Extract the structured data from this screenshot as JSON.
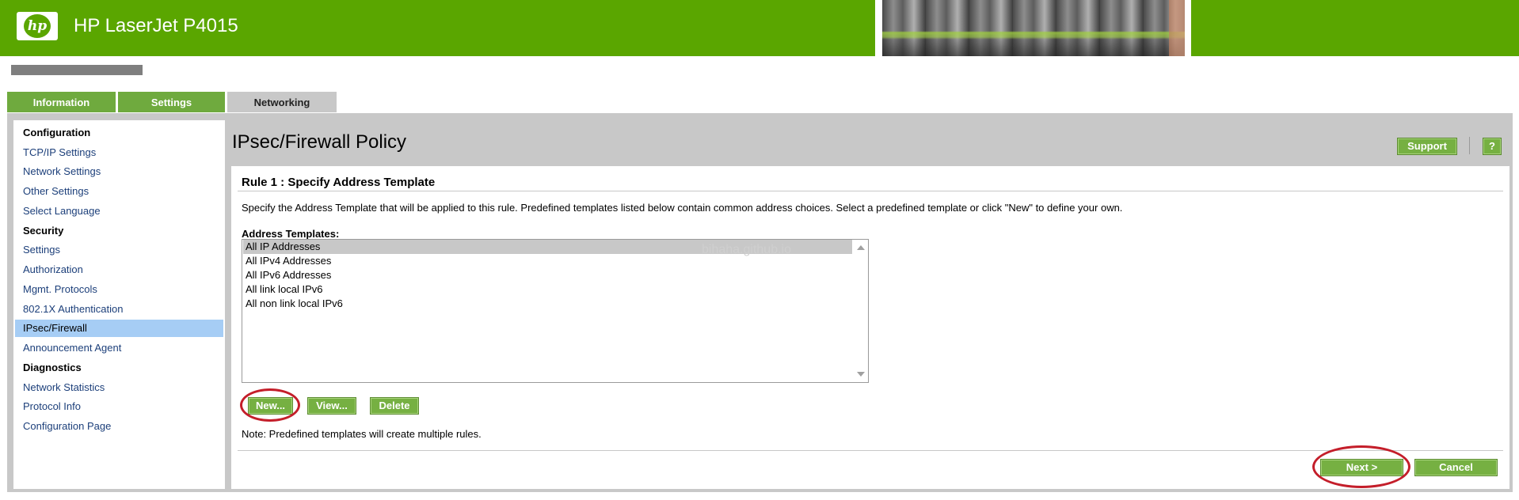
{
  "header": {
    "logo_text": "hp",
    "product_name": "HP LaserJet P4015"
  },
  "tabs": [
    {
      "label": "Information"
    },
    {
      "label": "Settings"
    },
    {
      "label": "Networking"
    }
  ],
  "sidebar": {
    "items": [
      {
        "label": "Configuration",
        "type": "heading"
      },
      {
        "label": "TCP/IP Settings",
        "type": "link"
      },
      {
        "label": "Network Settings",
        "type": "link"
      },
      {
        "label": "Other Settings",
        "type": "link"
      },
      {
        "label": "Select Language",
        "type": "link"
      },
      {
        "label": "Security",
        "type": "heading"
      },
      {
        "label": "Settings",
        "type": "link"
      },
      {
        "label": "Authorization",
        "type": "link"
      },
      {
        "label": "Mgmt. Protocols",
        "type": "link"
      },
      {
        "label": "802.1X Authentication",
        "type": "link"
      },
      {
        "label": "IPsec/Firewall",
        "type": "link",
        "selected": true
      },
      {
        "label": "Announcement Agent",
        "type": "link"
      },
      {
        "label": "Diagnostics",
        "type": "heading"
      },
      {
        "label": "Network Statistics",
        "type": "link"
      },
      {
        "label": "Protocol Info",
        "type": "link"
      },
      {
        "label": "Configuration Page",
        "type": "link"
      }
    ]
  },
  "main": {
    "page_title": "IPsec/Firewall Policy",
    "support_label": "Support",
    "help_label": "?",
    "rule_title": "Rule 1 : Specify Address Template",
    "description": "Specify the Address Template that will be applied to this rule. Predefined templates listed below contain common address choices. Select a predefined template or click \"New\" to define your own.",
    "templates_label": "Address Templates:",
    "templates": [
      "All IP Addresses",
      "All IPv4 Addresses",
      "All IPv6 Addresses",
      "All link local IPv6",
      "All non link local IPv6"
    ],
    "selected_template": "All IP Addresses",
    "watermark": "bihaha.github.io",
    "buttons": {
      "new": "New...",
      "view": "View...",
      "delete": "Delete"
    },
    "note": "Note: Predefined templates will create multiple rules.",
    "next": "Next >",
    "cancel": "Cancel"
  },
  "colors": {
    "brand_green": "#5aa600",
    "button_green": "#76b042",
    "selected_nav": "#a6cdf5",
    "annotation_red": "#c41e2a"
  }
}
